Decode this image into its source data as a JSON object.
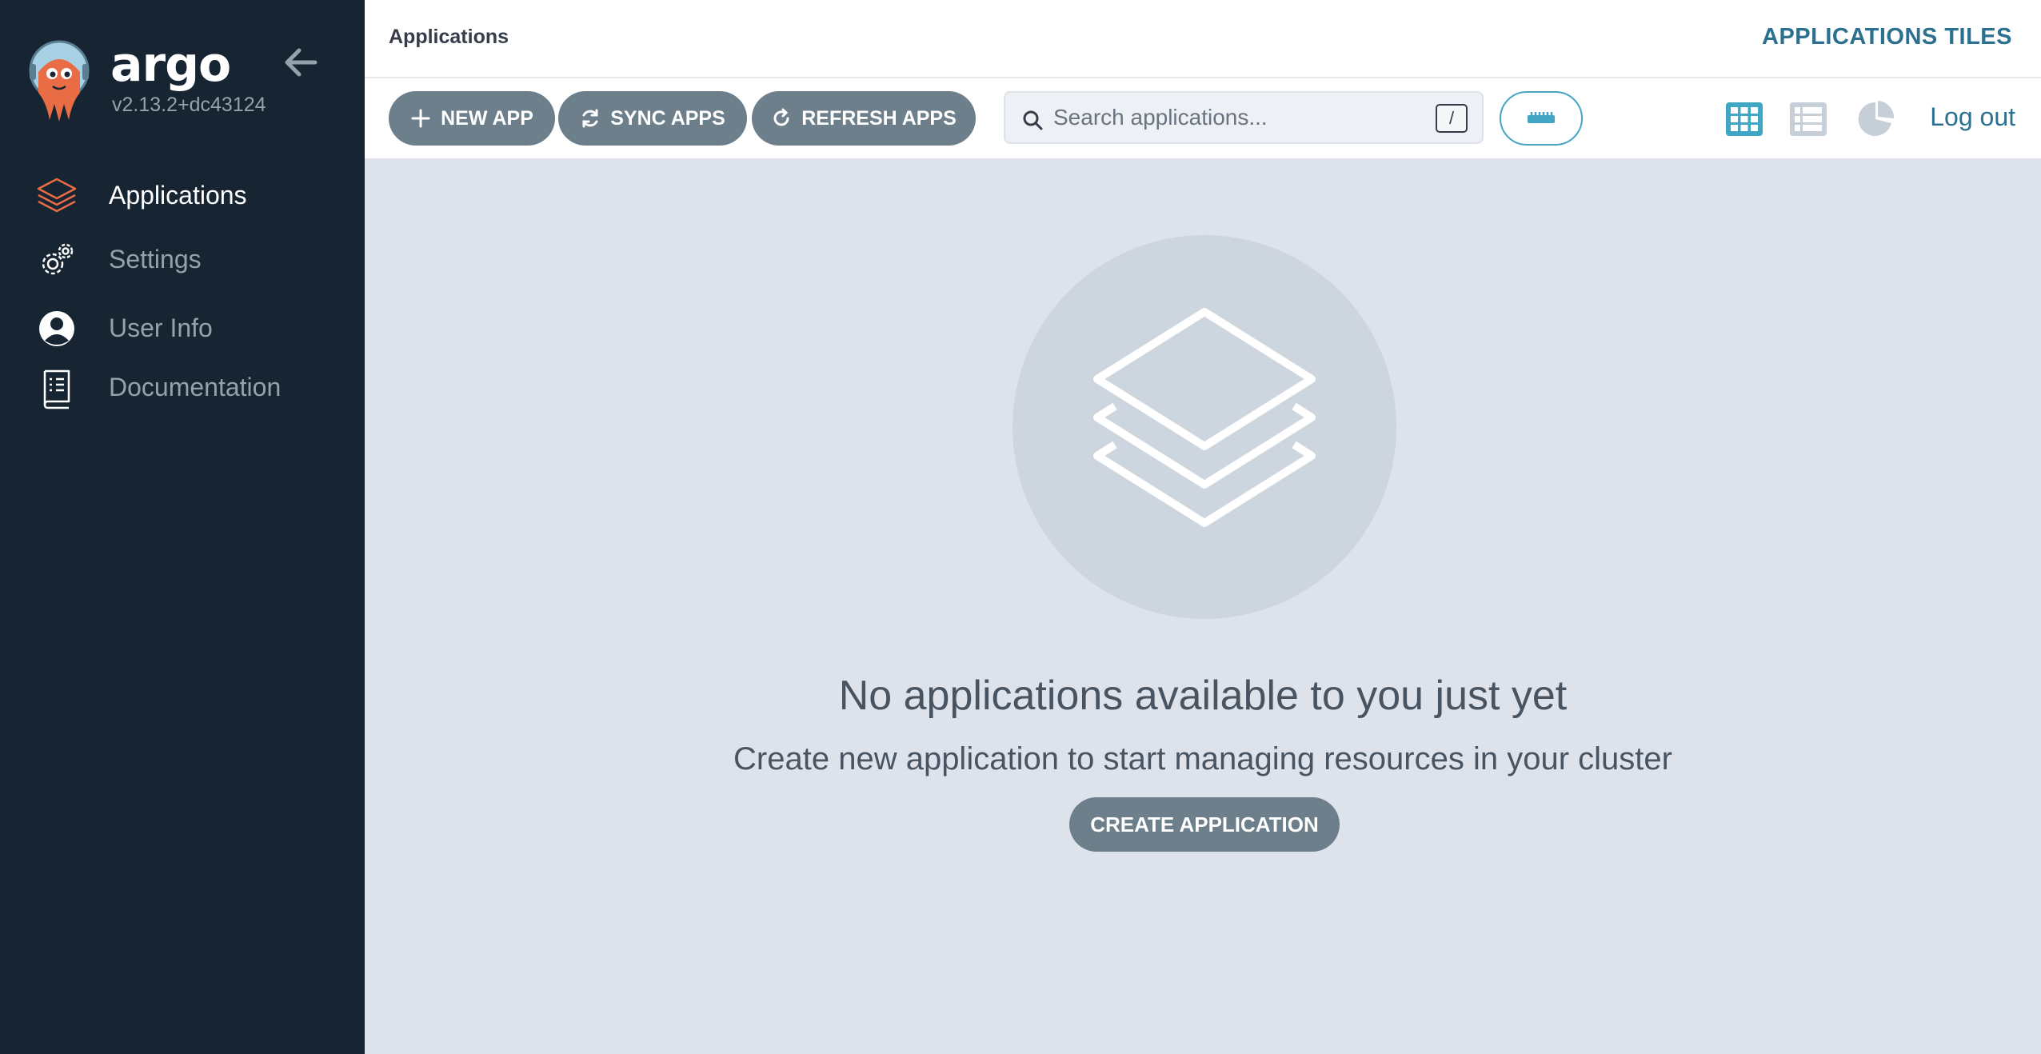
{
  "sidebar": {
    "brand": "argo",
    "version": "v2.13.2+dc43124",
    "items": [
      {
        "label": "Applications",
        "active": true
      },
      {
        "label": "Settings",
        "active": false
      },
      {
        "label": "User Info",
        "active": false
      },
      {
        "label": "Documentation",
        "active": false
      }
    ]
  },
  "header": {
    "breadcrumb": "Applications",
    "view_title": "APPLICATIONS TILES"
  },
  "toolbar": {
    "new_app": "NEW APP",
    "sync_apps": "SYNC APPS",
    "refresh_apps": "REFRESH APPS",
    "search_placeholder": "Search applications...",
    "search_shortcut": "/",
    "logout": "Log out"
  },
  "empty_state": {
    "title": "No applications available to you just yet",
    "subtitle": "Create new application to start managing resources in your cluster",
    "button": "CREATE APPLICATION"
  },
  "colors": {
    "sidebar_bg": "#172432",
    "accent": "#2c7090",
    "active_icon": "#e96d44",
    "button_bg": "#6d7f8b",
    "content_bg": "#dee3eb"
  },
  "icons": {
    "logo": "argo-octopus-logo",
    "collapse": "arrow-left-icon",
    "applications": "layers-icon",
    "settings": "gears-icon",
    "user_info": "user-circle-icon",
    "documentation": "book-icon",
    "tiles_view": "grid-icon",
    "list_view": "list-icon",
    "summary_view": "pie-chart-icon",
    "filter": "ruler-icon"
  }
}
